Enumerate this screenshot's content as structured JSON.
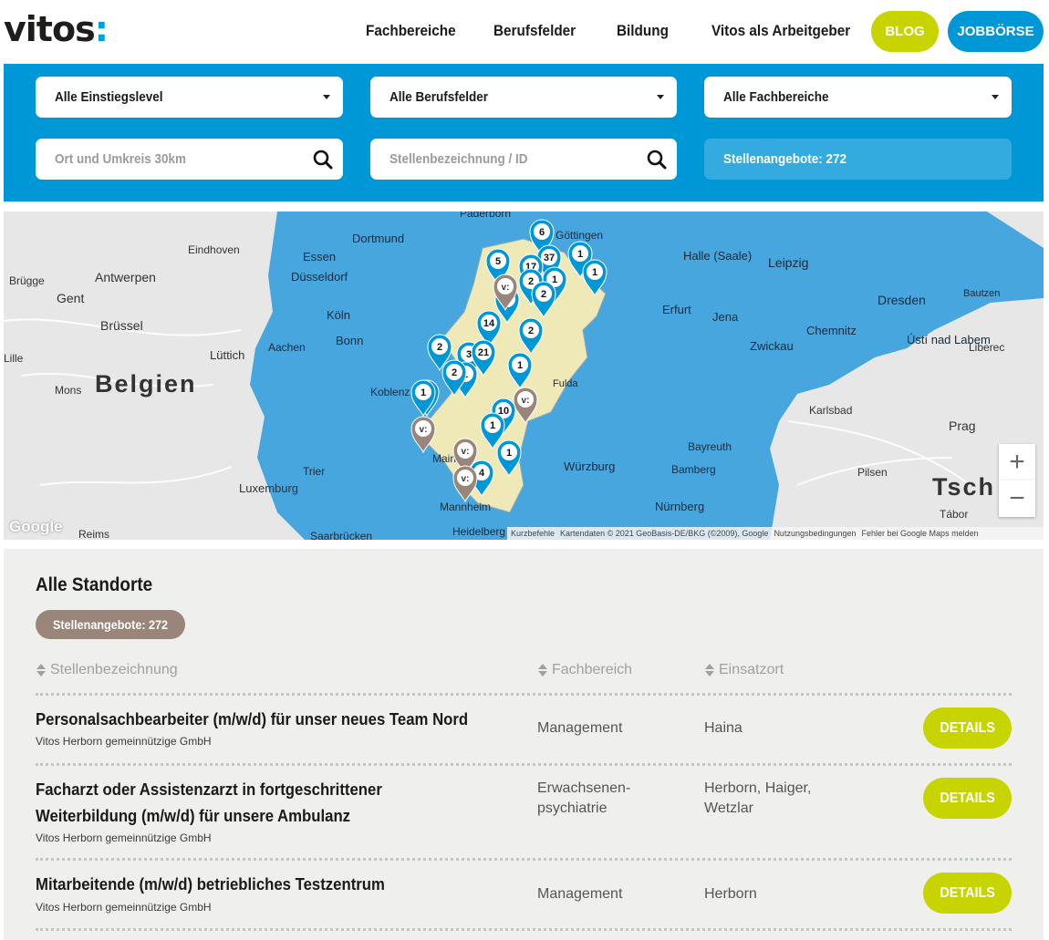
{
  "header": {
    "logo_text": "vitos",
    "logo_dots": ":",
    "nav": [
      "Fachbereiche",
      "Berufsfelder",
      "Bildung",
      "Vitos als Arbeitgeber"
    ],
    "blog_label": "BLOG",
    "jobs_label": "JOBBÖRSE"
  },
  "filters": {
    "level_select": "Alle Einstiegslevel",
    "field_select": "Alle Berufsfelder",
    "department_select": "Alle Fachbereiche",
    "location_placeholder": "Ort und Umkreis 30km",
    "title_placeholder": "Stellenbezeichnung / ID",
    "offers_count": "Stellenangebote: 272"
  },
  "map": {
    "cities": [
      {
        "name": "Eindhoven"
      },
      {
        "name": "Antwerpen"
      },
      {
        "name": "Brügge"
      },
      {
        "name": "Gent"
      },
      {
        "name": "Brüssel"
      },
      {
        "name": "Belgien"
      },
      {
        "name": "Lüttich"
      },
      {
        "name": "Mons"
      },
      {
        "name": "Lille"
      },
      {
        "name": "Luxemburg"
      },
      {
        "name": "Reims"
      },
      {
        "name": "Dortmund"
      },
      {
        "name": "Essen"
      },
      {
        "name": "Düsseldorf"
      },
      {
        "name": "Köln"
      },
      {
        "name": "Bonn"
      },
      {
        "name": "Aachen"
      },
      {
        "name": "Koblenz"
      },
      {
        "name": "Trier"
      },
      {
        "name": "Mainz"
      },
      {
        "name": "Mannheim"
      },
      {
        "name": "Heidelberg"
      },
      {
        "name": "Saarbrücken"
      },
      {
        "name": "Paderborn"
      },
      {
        "name": "Göttingen"
      },
      {
        "name": "Halle (Saale)"
      },
      {
        "name": "Leipzig"
      },
      {
        "name": "Dresden"
      },
      {
        "name": "Bautzen"
      },
      {
        "name": "Erfurt"
      },
      {
        "name": "Jena"
      },
      {
        "name": "Chemnitz"
      },
      {
        "name": "Zwickau"
      },
      {
        "name": "Ústí nad Labem"
      },
      {
        "name": "Liberec"
      },
      {
        "name": "Fulda"
      },
      {
        "name": "Würzburg"
      },
      {
        "name": "Bamberg"
      },
      {
        "name": "Bayreuth"
      },
      {
        "name": "Nürnberg"
      },
      {
        "name": "Karlsbad"
      },
      {
        "name": "Prag"
      },
      {
        "name": "Pilsen"
      },
      {
        "name": "Tábor"
      },
      {
        "name": "Tsch"
      }
    ],
    "markers": [
      {
        "label": "6"
      },
      {
        "label": "37"
      },
      {
        "label": "17"
      },
      {
        "label": "5"
      },
      {
        "label": "1"
      },
      {
        "label": "1"
      },
      {
        "label": "2"
      },
      {
        "label": "1"
      },
      {
        "label": "14"
      },
      {
        "label": "2"
      },
      {
        "label": "2"
      },
      {
        "label": "3"
      },
      {
        "label": "21"
      },
      {
        "label": "1"
      },
      {
        "label": "2"
      },
      {
        "label": "1"
      },
      {
        "label": "1"
      },
      {
        "label": "10"
      },
      {
        "label": "1"
      },
      {
        "label": "1"
      },
      {
        "label": "4"
      },
      {
        "label": "1"
      },
      {
        "label": "2"
      },
      {
        "label": "1"
      }
    ],
    "vitos_marker_label": "v:",
    "zoom_in": "+",
    "zoom_out": "−",
    "google": "Google",
    "footer": {
      "shortcuts": "Kurzbefehle",
      "copyright": "Kartendaten © 2021 GeoBasis-DE/BKG (©2009), Google",
      "terms": "Nutzungsbedingungen",
      "report": "Fehler bei Google Maps melden"
    }
  },
  "listing": {
    "title": "Alle Standorte",
    "badge": "Stellenangebote: 272",
    "columns": [
      "Stellenbezeichnung",
      "Fachbereich",
      "Einsatzort"
    ],
    "details_label": "DETAILS",
    "jobs": [
      {
        "title": "Personalsachbearbeiter (m/w/d) für unser neues Team Nord",
        "org": "Vitos Herborn gemeinnützige GmbH",
        "department": "Management",
        "location": "Haina"
      },
      {
        "title": "Facharzt oder Assistenzarzt in fortgeschrittener Weiterbildung (m/w/d) für unsere Ambulanz",
        "org": "Vitos Herborn gemeinnützige GmbH",
        "department": "Erwachsenen-psychiatrie",
        "location": "Herborn, Haiger, Wetzlar"
      },
      {
        "title": "Mitarbeitende (m/w/d) betriebliches Testzentrum",
        "org": "Vitos Herborn gemeinnützige GmbH",
        "department": "Management",
        "location": "Herborn"
      }
    ]
  },
  "colors": {
    "brand_blue": "#0097d7",
    "brand_green": "#c8d400",
    "brand_taupe": "#9a857a"
  }
}
